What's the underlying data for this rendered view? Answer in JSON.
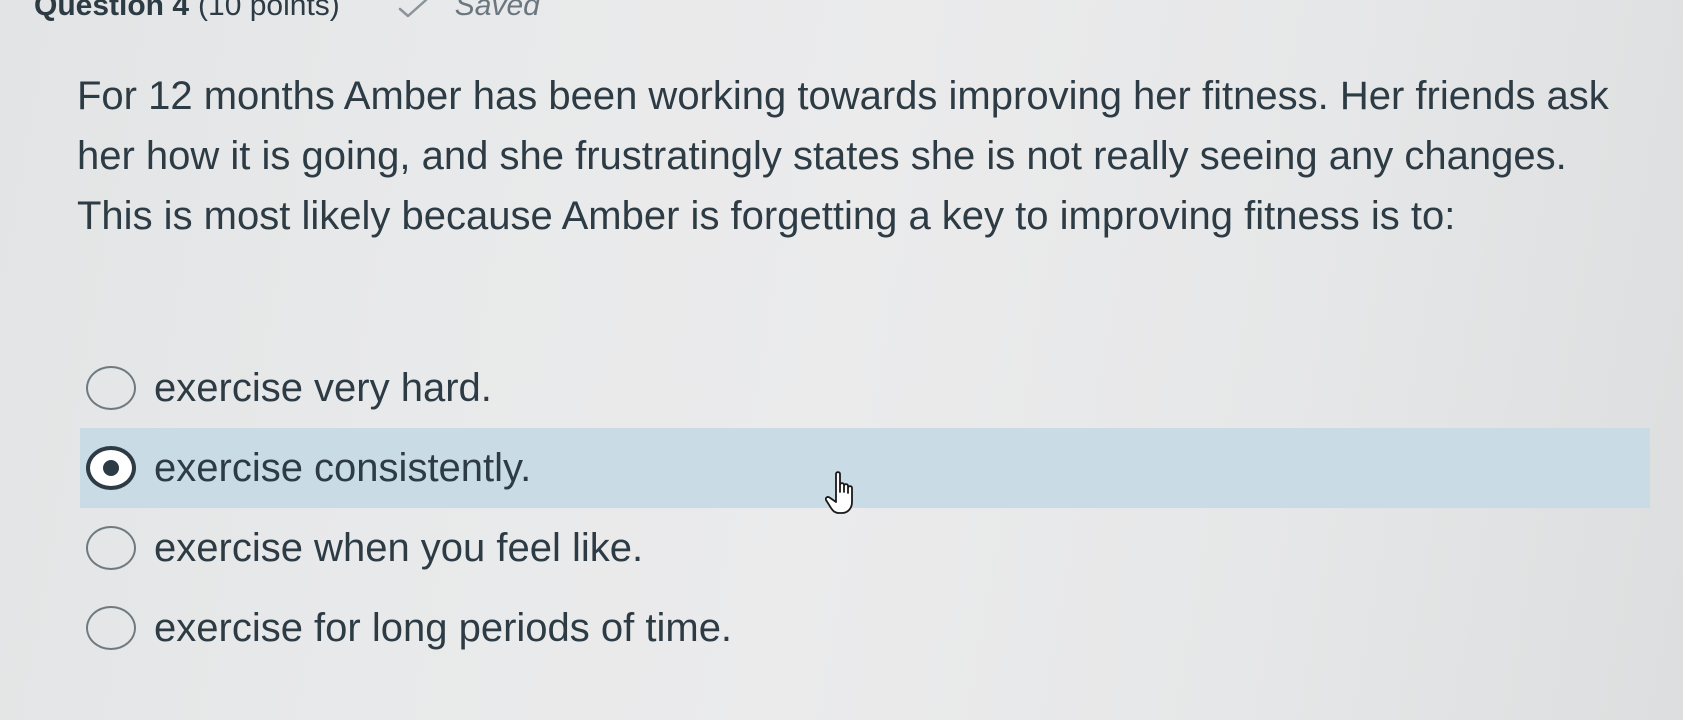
{
  "question": {
    "title": "Question 4",
    "points": "(10 points)",
    "status": "Saved",
    "status_icon": "check-icon",
    "text": "For 12 months Amber has been working towards improving her fitness. Her friends ask her how it is going, and she frustratingly states she is not really seeing any changes. This is most likely because Amber is forgetting a key to improving fitness is to:"
  },
  "answers": [
    {
      "label": "exercise very hard.",
      "selected": false
    },
    {
      "label": "exercise consistently.",
      "selected": true
    },
    {
      "label": "exercise when you feel like.",
      "selected": false
    },
    {
      "label": "exercise for long periods of time.",
      "selected": false
    }
  ],
  "colors": {
    "text": "#2d3b45",
    "selected_background": "#c9dbe5",
    "status_text": "#6b777f"
  },
  "cursor": "pointer-hand-icon"
}
